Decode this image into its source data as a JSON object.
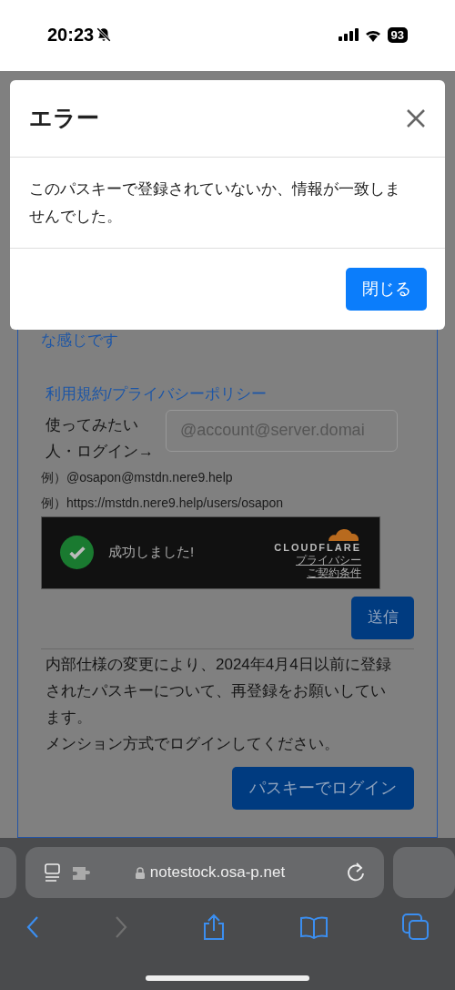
{
  "status_bar": {
    "time": "20:23",
    "battery": "93"
  },
  "page": {
    "intro_tail": "な感じです",
    "terms_link": "利用規約/プライバシーポリシー",
    "login_label": "使ってみたい人・ログイン→",
    "account_field": {
      "placeholder": "@account@server.domai"
    },
    "examples": [
      "例）@osapon@mstdn.nere9.help",
      "例）https://mstdn.nere9.help/users/osapon"
    ],
    "captcha": {
      "checked": true,
      "message": "成功しました!",
      "brand": "CLOUDFLARE",
      "links": [
        "プライバシー",
        "ご契約条件"
      ]
    },
    "submit_button": "送信",
    "notice": [
      "内部仕様の変更により、2024年4月4日以前に登録されたパスキーについて、再登録をお願いしています。",
      "メンション方式でログインしてください。"
    ],
    "passkey_button": "パスキーでログイン"
  },
  "modal": {
    "title": "エラー",
    "message": "このパスキーで登録されていないか、情報が一致しませんでした。",
    "close_button": "閉じる"
  },
  "browser": {
    "url": "notestock.osa-p.net"
  }
}
